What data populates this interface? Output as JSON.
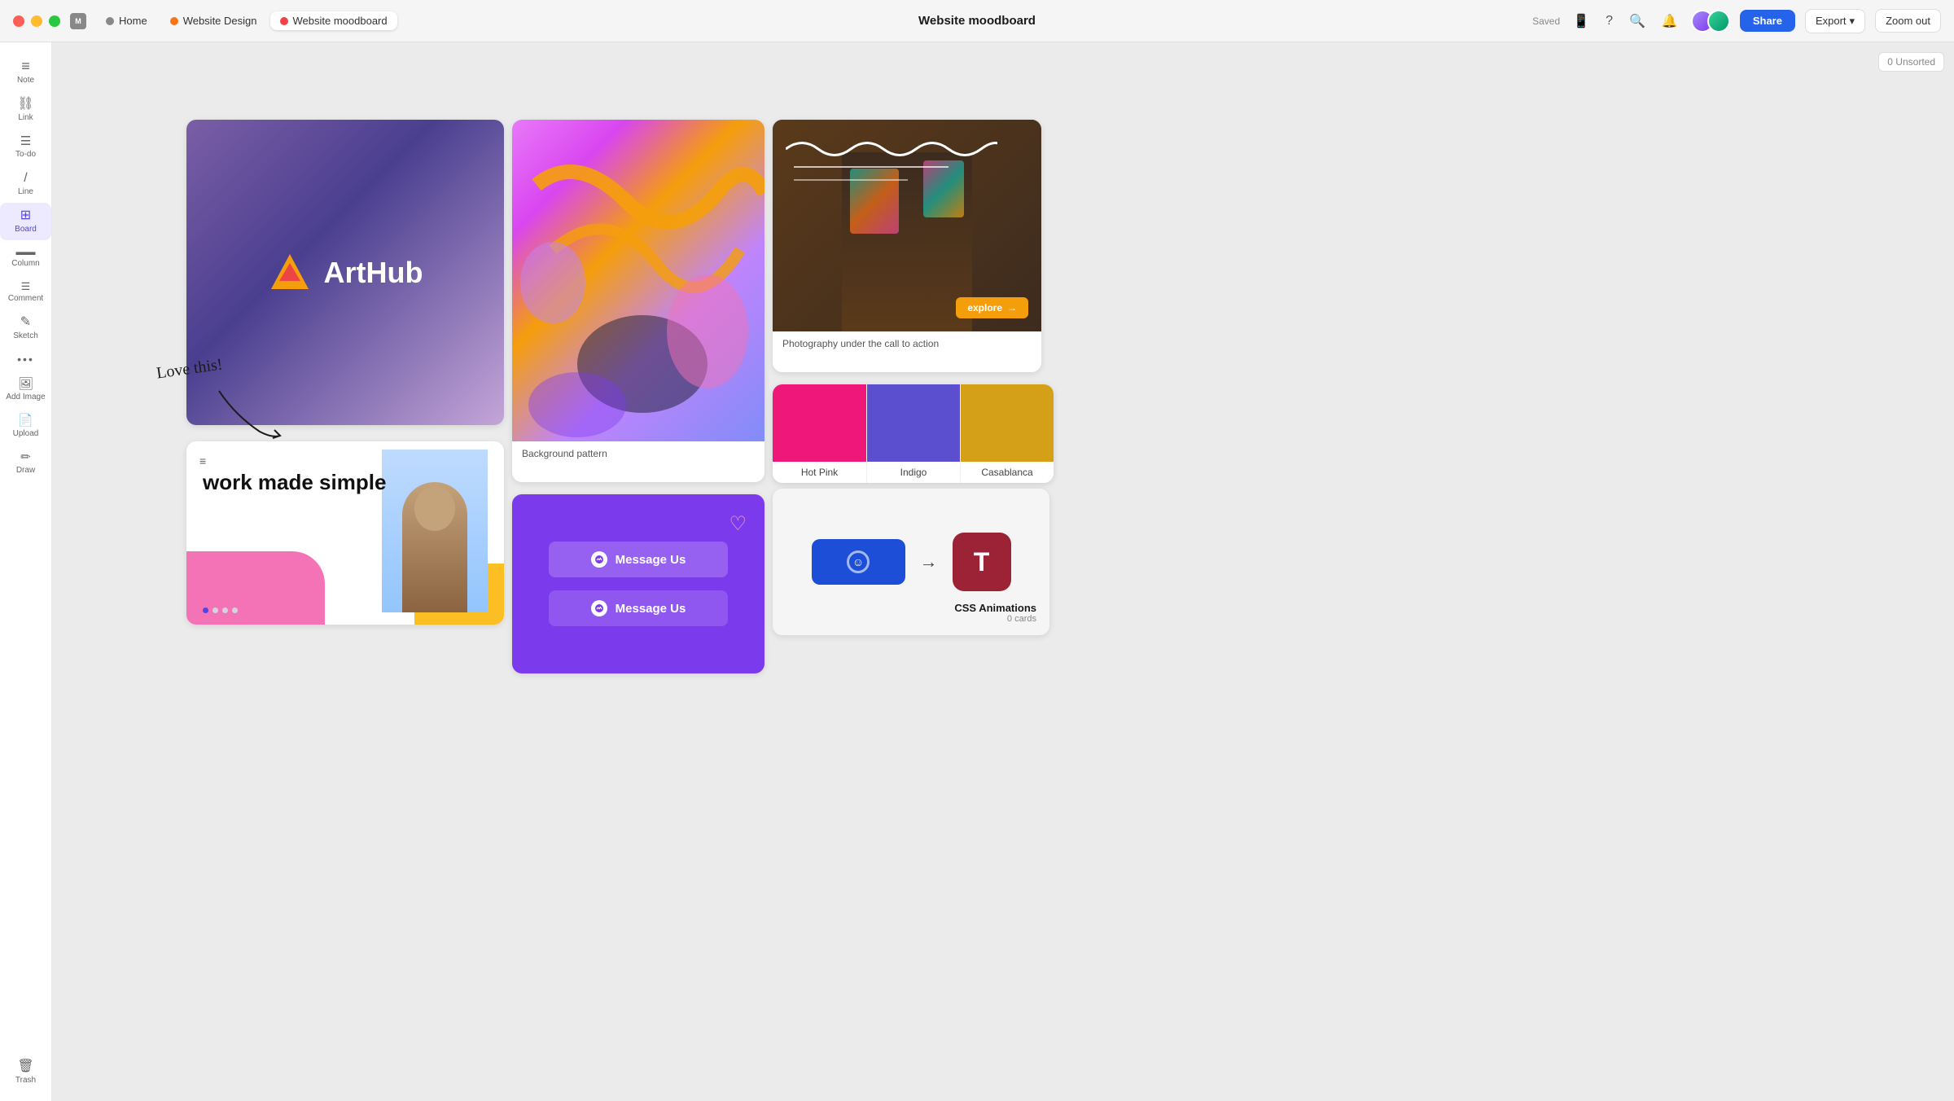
{
  "titlebar": {
    "title": "Website moodboard",
    "saved_label": "Saved",
    "tabs": [
      {
        "id": "home",
        "label": "Home",
        "color": "#888",
        "active": false
      },
      {
        "id": "website-design",
        "label": "Website Design",
        "color": "#f97316",
        "active": false
      },
      {
        "id": "website-moodboard",
        "label": "Website moodboard",
        "color": "#ef4444",
        "active": true
      }
    ],
    "share_label": "Share",
    "export_label": "Export",
    "zoomout_label": "Zoom out"
  },
  "sidebar": {
    "items": [
      {
        "id": "note",
        "label": "Note",
        "icon": "≡"
      },
      {
        "id": "link",
        "label": "Link",
        "icon": "🔗"
      },
      {
        "id": "todo",
        "label": "To-do",
        "icon": "☰"
      },
      {
        "id": "line",
        "label": "Line",
        "icon": "✏"
      },
      {
        "id": "board",
        "label": "Board",
        "icon": "⊞",
        "active": true
      },
      {
        "id": "column",
        "label": "Column",
        "icon": "▬"
      },
      {
        "id": "comment",
        "label": "Comment",
        "icon": "☰"
      },
      {
        "id": "sketch",
        "label": "Sketch",
        "icon": "✎"
      },
      {
        "id": "more",
        "label": "•••",
        "icon": "•••"
      },
      {
        "id": "add-image",
        "label": "Add Image",
        "icon": "🖼"
      },
      {
        "id": "upload",
        "label": "Upload",
        "icon": "📄"
      },
      {
        "id": "draw",
        "label": "Draw",
        "icon": "✏"
      }
    ],
    "trash_label": "Trash"
  },
  "canvas": {
    "unsorted_label": "0 Unsorted",
    "cards": {
      "arthub": {
        "logo_text": "ArtHub"
      },
      "bg_pattern": {
        "label": "Background pattern"
      },
      "photography": {
        "label": "Photography under the call to action"
      },
      "work": {
        "text": "work made simple"
      },
      "message": {
        "btn1": "Message Us",
        "btn2": "Message Us"
      },
      "swatches": [
        {
          "color": "#f0177a",
          "label": "Hot Pink"
        },
        {
          "color": "#5b4fcf",
          "label": "Indigo"
        },
        {
          "color": "#d4a017",
          "label": "Casablanca"
        }
      ],
      "css_animations": {
        "label": "CSS Animations",
        "cards": "0 cards"
      }
    },
    "annotation": "Love this!"
  }
}
